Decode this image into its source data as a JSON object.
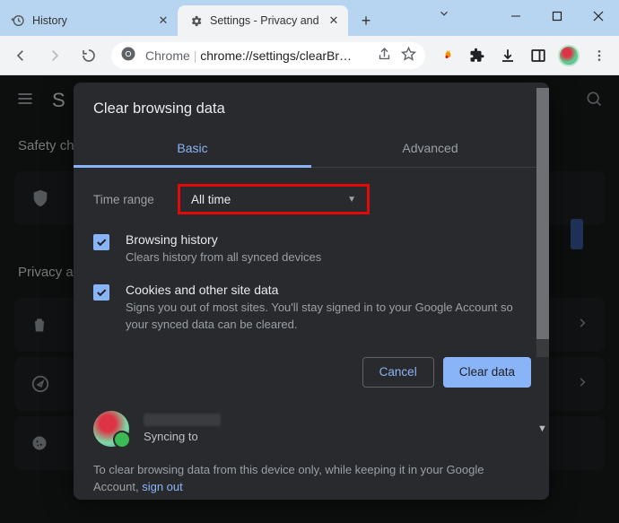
{
  "window": {
    "tabs": [
      {
        "title": "History",
        "active": false
      },
      {
        "title": "Settings - Privacy and",
        "active": true
      }
    ]
  },
  "toolbar": {
    "address_prefix": "Chrome",
    "address_url": "chrome://settings/clearBr…"
  },
  "background": {
    "brand_initial": "S",
    "section1": "Safety ch",
    "section2": "Privacy a"
  },
  "modal": {
    "title": "Clear browsing data",
    "tabs": {
      "basic": "Basic",
      "advanced": "Advanced",
      "active": "basic"
    },
    "time_range_label": "Time range",
    "time_range_value": "All time",
    "options": [
      {
        "checked": true,
        "title": "Browsing history",
        "subtitle": "Clears history from all synced devices"
      },
      {
        "checked": true,
        "title": "Cookies and other site data",
        "subtitle": "Signs you out of most sites. You'll stay signed in to your Google Account so your synced data can be cleared."
      }
    ],
    "buttons": {
      "cancel": "Cancel",
      "confirm": "Clear data"
    },
    "sync_label": "Syncing to",
    "footnote_pre": "To clear browsing data from this device only, while keeping it in your Google Account, ",
    "footnote_link": "sign out"
  }
}
